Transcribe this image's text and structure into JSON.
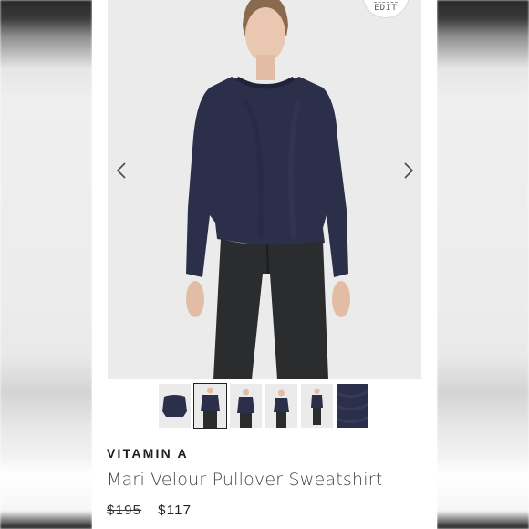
{
  "badge": {
    "label": "EDIT"
  },
  "product": {
    "brand": "VITAMIN A",
    "name": "Mari Velour Pullover Sweatshirt",
    "original_price": "$195",
    "sale_price": "$117"
  },
  "gallery": {
    "thumbnail_count": 6,
    "active_index": 1
  },
  "colors": {
    "sweater": "#2b2f4a",
    "jeans": "#2a2c2e",
    "background": "#ebebeb"
  }
}
